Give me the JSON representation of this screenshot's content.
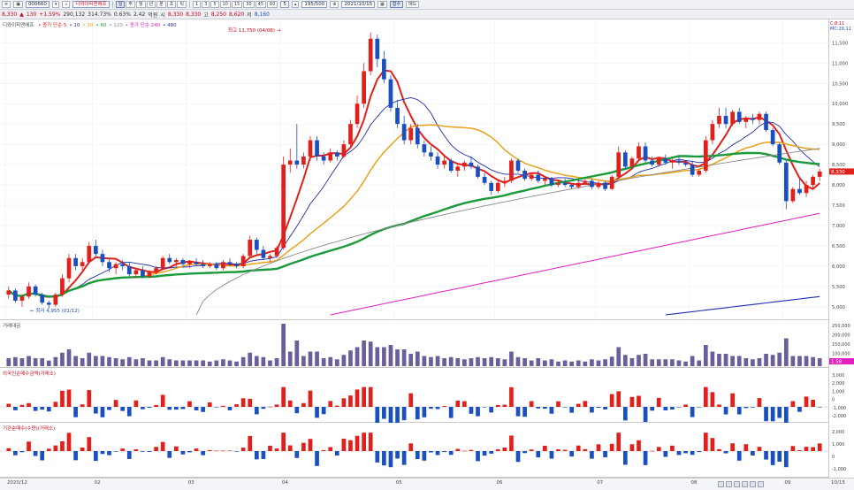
{
  "toolbar1": {
    "code": "000660",
    "stock_name": "디와이피엔에프",
    "periods": [
      "일",
      "주",
      "월",
      "년",
      "분",
      "초",
      "틱"
    ],
    "minutes": [
      "1",
      "3",
      "5",
      "10",
      "15",
      "30",
      "45",
      "60"
    ],
    "count_value": "5",
    "range_display": "195/500",
    "date_value": "2021/10/15",
    "func_label": "함수",
    "draw_label": "매도"
  },
  "toolbar2": {
    "price": "8,330",
    "change_arrow": "▲",
    "change": "130",
    "change_pct": "+1.59%",
    "volume": "290,132",
    "volume_ratio": "314.73%",
    "amount": "2.42",
    "amount_unit": "억원",
    "open_label": "시",
    "open": "8,330",
    "open2": "8,330",
    "high_label": "고",
    "high": "8,250",
    "mid": "8,620",
    "low_label": "저",
    "low": "8,160",
    "extra": "0.63%"
  },
  "price_panel": {
    "legend_name": "디와이피엔에프",
    "legend_items": [
      {
        "label": "종가 단순 5",
        "color": "#e0201b"
      },
      {
        "label": "10",
        "color": "#1f2fa8"
      },
      {
        "label": "20",
        "color": "#e8a21a"
      },
      {
        "label": "60",
        "color": "#1a9a3a"
      },
      {
        "label": "120",
        "color": "#8a8a8a"
      },
      {
        "label": "종가 단순 240",
        "color": "#e020c0"
      },
      {
        "label": "480",
        "color": "#1f2fa8"
      }
    ],
    "top_right_labels": [
      "C:8,11",
      "MC:29,11"
    ],
    "high_annotation": "최고 11,750 (04/08) →",
    "low_annotation": "← 최저 4,955 (01/12)",
    "current_price_tag": "8,330",
    "axis_ticks": [
      "11,500",
      "11,000",
      "10,500",
      "10,000",
      "9,500",
      "9,000",
      "8,500",
      "8,000",
      "7,500",
      "7,000",
      "6,500",
      "6,000",
      "5,500",
      "5,000"
    ]
  },
  "volume_panel": {
    "title": "거래대금",
    "axis_ticks": [
      "250,000",
      "200,000",
      "150,000",
      "100,000",
      "50,000"
    ],
    "current_tag": "1.58"
  },
  "inst_panel": {
    "title": "외국인순매수금액(거래소)",
    "axis_ticks": [
      "3,000",
      "2,000",
      "1,000",
      "0",
      "-1,000",
      "-2,000"
    ]
  },
  "inv_panel": {
    "title": "기관순매수(수량)(거래소)",
    "axis_ticks": [
      "2,000",
      "1,000",
      "0",
      "-1,000"
    ]
  },
  "xaxis": {
    "labels": [
      "2020/12",
      "02",
      "03",
      "04",
      "05",
      "06",
      "07",
      "08",
      "09",
      "10",
      "10/15"
    ]
  },
  "chart_data": {
    "type": "candlestick",
    "y_range": [
      4800,
      11900
    ],
    "candles": [
      [
        5300,
        5500,
        5200,
        5400
      ],
      [
        5400,
        5450,
        5100,
        5150
      ],
      [
        5150,
        5300,
        5000,
        5250
      ],
      [
        5250,
        5600,
        5200,
        5500
      ],
      [
        5500,
        5550,
        5250,
        5300
      ],
      [
        5300,
        5350,
        5050,
        5100
      ],
      [
        5100,
        5150,
        4955,
        5050
      ],
      [
        5050,
        5350,
        5000,
        5300
      ],
      [
        5300,
        5800,
        5250,
        5700
      ],
      [
        5700,
        6300,
        5600,
        6200
      ],
      [
        6200,
        6300,
        5900,
        6000
      ],
      [
        6000,
        6200,
        5900,
        6100
      ],
      [
        6100,
        6600,
        6050,
        6500
      ],
      [
        6500,
        6650,
        6250,
        6300
      ],
      [
        6300,
        6400,
        6000,
        6100
      ],
      [
        6100,
        6200,
        5850,
        5950
      ],
      [
        5950,
        6100,
        5800,
        6050
      ],
      [
        6050,
        6150,
        5900,
        6000
      ],
      [
        6000,
        6100,
        5750,
        5800
      ],
      [
        5800,
        5950,
        5700,
        5900
      ],
      [
        5900,
        6000,
        5700,
        5750
      ],
      [
        5750,
        5900,
        5700,
        5850
      ],
      [
        5850,
        6000,
        5800,
        5950
      ],
      [
        5950,
        6250,
        5900,
        6200
      ],
      [
        6200,
        6300,
        6050,
        6100
      ],
      [
        6100,
        6200,
        6000,
        6150
      ],
      [
        6150,
        6200,
        6000,
        6050
      ],
      [
        6050,
        6150,
        5950,
        6100
      ],
      [
        6100,
        6200,
        6000,
        6050
      ],
      [
        6050,
        6150,
        5950,
        6000
      ],
      [
        6000,
        6100,
        5950,
        6050
      ],
      [
        6050,
        6100,
        5900,
        5950
      ],
      [
        5950,
        6150,
        5900,
        6100
      ],
      [
        6100,
        6200,
        6000,
        6050
      ],
      [
        6050,
        6100,
        5950,
        6000
      ],
      [
        6000,
        6300,
        5950,
        6250
      ],
      [
        6250,
        6750,
        6200,
        6650
      ],
      [
        6650,
        6700,
        6300,
        6400
      ],
      [
        6400,
        6500,
        6150,
        6200
      ],
      [
        6200,
        6300,
        6100,
        6250
      ],
      [
        6250,
        6500,
        6200,
        6450
      ],
      [
        6450,
        8700,
        6400,
        8500
      ],
      [
        8500,
        8900,
        8300,
        8600
      ],
      [
        8600,
        9500,
        8400,
        8500
      ],
      [
        8500,
        8800,
        8400,
        8700
      ],
      [
        8700,
        9200,
        8600,
        9100
      ],
      [
        9100,
        9200,
        8600,
        8700
      ],
      [
        8700,
        8800,
        8500,
        8600
      ],
      [
        8600,
        8900,
        8550,
        8800
      ],
      [
        8800,
        8850,
        8600,
        8700
      ],
      [
        8700,
        9100,
        8650,
        9000
      ],
      [
        9000,
        9600,
        8950,
        9500
      ],
      [
        9500,
        10200,
        9400,
        10000
      ],
      [
        10000,
        11000,
        9900,
        10800
      ],
      [
        10800,
        11750,
        10700,
        11600
      ],
      [
        11600,
        11700,
        10900,
        11100
      ],
      [
        11100,
        11300,
        10500,
        10600
      ],
      [
        10600,
        10700,
        9800,
        9900
      ],
      [
        9900,
        10100,
        9400,
        9500
      ],
      [
        9500,
        9700,
        9000,
        9100
      ],
      [
        9100,
        9500,
        9000,
        9400
      ],
      [
        9400,
        9500,
        8900,
        9000
      ],
      [
        9000,
        9100,
        8700,
        8800
      ],
      [
        8800,
        8950,
        8600,
        8700
      ],
      [
        8700,
        8800,
        8400,
        8500
      ],
      [
        8500,
        8700,
        8400,
        8600
      ],
      [
        8600,
        8650,
        8300,
        8350
      ],
      [
        8350,
        8500,
        8200,
        8450
      ],
      [
        8450,
        8600,
        8350,
        8550
      ],
      [
        8550,
        8700,
        8400,
        8450
      ],
      [
        8450,
        8500,
        8150,
        8200
      ],
      [
        8200,
        8300,
        8000,
        8050
      ],
      [
        8050,
        8100,
        7750,
        7850
      ],
      [
        7850,
        8100,
        7800,
        8050
      ],
      [
        8050,
        8200,
        7950,
        8100
      ],
      [
        8100,
        8650,
        8050,
        8600
      ],
      [
        8600,
        8650,
        8300,
        8350
      ],
      [
        8350,
        8400,
        8100,
        8150
      ],
      [
        8150,
        8300,
        8100,
        8250
      ],
      [
        8250,
        8350,
        8050,
        8100
      ],
      [
        8100,
        8200,
        8000,
        8150
      ],
      [
        8150,
        8200,
        7950,
        8000
      ],
      [
        8000,
        8100,
        7950,
        8050
      ],
      [
        8050,
        8150,
        7950,
        8000
      ],
      [
        8000,
        8050,
        7900,
        7950
      ],
      [
        7950,
        8100,
        7900,
        8050
      ],
      [
        8050,
        8150,
        8000,
        8100
      ],
      [
        8100,
        8150,
        7900,
        7950
      ],
      [
        7950,
        8100,
        7900,
        8050
      ],
      [
        8050,
        8100,
        7850,
        7900
      ],
      [
        7900,
        8250,
        7880,
        8200
      ],
      [
        8200,
        8950,
        8150,
        8800
      ],
      [
        8800,
        8850,
        8400,
        8450
      ],
      [
        8450,
        8700,
        8400,
        8650
      ],
      [
        8650,
        9050,
        8600,
        8950
      ],
      [
        8950,
        9050,
        8550,
        8600
      ],
      [
        8600,
        8700,
        8450,
        8500
      ],
      [
        8500,
        8700,
        8450,
        8650
      ],
      [
        8650,
        8750,
        8500,
        8550
      ],
      [
        8550,
        8650,
        8400,
        8600
      ],
      [
        8600,
        8700,
        8500,
        8550
      ],
      [
        8550,
        8600,
        8450,
        8500
      ],
      [
        8500,
        8600,
        8200,
        8250
      ],
      [
        8250,
        8400,
        8200,
        8350
      ],
      [
        8350,
        9200,
        8300,
        9100
      ],
      [
        9100,
        9600,
        9000,
        9500
      ],
      [
        9500,
        9900,
        9400,
        9700
      ],
      [
        9700,
        9900,
        9400,
        9500
      ],
      [
        9500,
        9850,
        9450,
        9800
      ],
      [
        9800,
        9900,
        9500,
        9550
      ],
      [
        9550,
        9700,
        9400,
        9650
      ],
      [
        9650,
        9750,
        9500,
        9600
      ],
      [
        9600,
        9800,
        9500,
        9750
      ],
      [
        9750,
        9800,
        9300,
        9350
      ],
      [
        9350,
        9400,
        8950,
        9000
      ],
      [
        9000,
        9050,
        8500,
        8550
      ],
      [
        8550,
        8600,
        7400,
        7600
      ],
      [
        7600,
        7950,
        7550,
        7900
      ],
      [
        7900,
        8150,
        7750,
        7800
      ],
      [
        7800,
        8100,
        7700,
        8000
      ],
      [
        8000,
        8250,
        7900,
        8200
      ],
      [
        8200,
        8400,
        8100,
        8330
      ]
    ]
  }
}
